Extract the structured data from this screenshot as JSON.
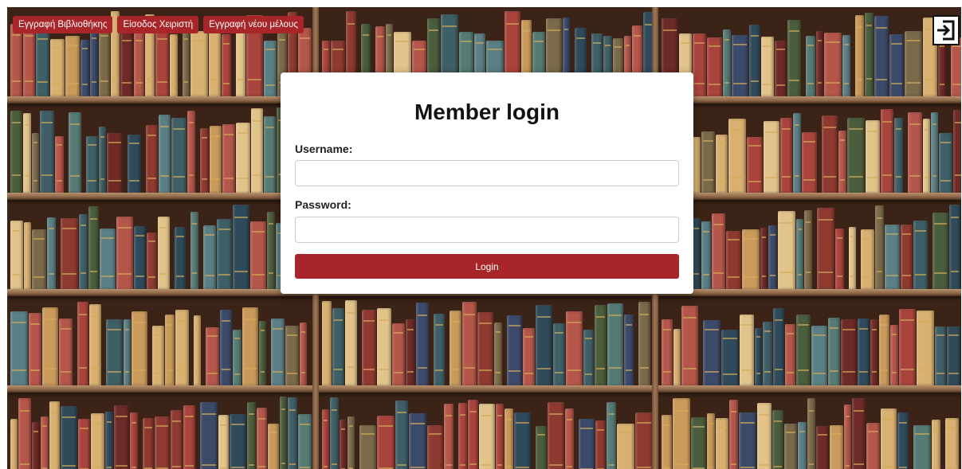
{
  "nav": {
    "items": [
      {
        "label": "Εγγραφή Βιβλιοθήκης"
      },
      {
        "label": "Είσοδος Χειριστή"
      },
      {
        "label": "Εγγραφή νέου μέλους"
      }
    ]
  },
  "logout": {
    "icon": "logout-icon"
  },
  "login": {
    "title": "Member login",
    "username_label": "Username:",
    "username_value": "",
    "password_label": "Password:",
    "password_value": "",
    "button_label": "Login"
  },
  "colors": {
    "accent": "#a8262a",
    "card": "#ffffff",
    "shelf_wood": "#3b2417"
  }
}
